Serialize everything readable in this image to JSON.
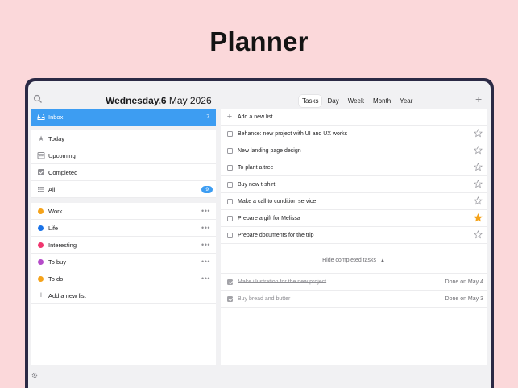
{
  "headline": "Planner",
  "topbar": {
    "date_bold": "Wednesday,6",
    "date_rest": " May 2026",
    "tabs": [
      "Tasks",
      "Day",
      "Week",
      "Month",
      "Year"
    ],
    "active_tab": "Tasks"
  },
  "sidebar": {
    "inbox": {
      "label": "Inbox",
      "count": "7"
    },
    "smart": [
      {
        "label": "Today",
        "icon": "star-icon"
      },
      {
        "label": "Upcoming",
        "icon": "calendar-icon"
      },
      {
        "label": "Completed",
        "icon": "check-icon"
      },
      {
        "label": "All",
        "icon": "list-icon",
        "count": "9"
      }
    ],
    "lists": [
      {
        "label": "Work",
        "color": "#f5a31a"
      },
      {
        "label": "Life",
        "color": "#1a73e8"
      },
      {
        "label": "Interesting",
        "color": "#f0366f"
      },
      {
        "label": "To buy",
        "color": "#b54bc9"
      },
      {
        "label": "To do",
        "color": "#f5a31a"
      }
    ],
    "add_list": "Add a new list"
  },
  "main": {
    "add_list": "Add a new list",
    "tasks": [
      {
        "label": "Behance: new project with UI and UX works",
        "starred": false
      },
      {
        "label": "New landing page design",
        "starred": false
      },
      {
        "label": "To plant a tree",
        "starred": false
      },
      {
        "label": "Buy new t-shirt",
        "starred": false
      },
      {
        "label": "Make a call to condition service",
        "starred": false
      },
      {
        "label": "Prepare a gift for Melissa",
        "starred": true
      },
      {
        "label": "Prepare documents for the trip",
        "starred": false
      }
    ],
    "hide_completed": "Hide completed tasks",
    "completed": [
      {
        "label": "Make illustration for the new project",
        "done_on": "Done on May 4"
      },
      {
        "label": "Buy bread and butter",
        "done_on": "Done on May 3"
      }
    ]
  },
  "colors": {
    "accent": "#3d9df2",
    "star_active": "#f5a31a",
    "background": "#fbd8da",
    "device": "#2b2a45"
  }
}
